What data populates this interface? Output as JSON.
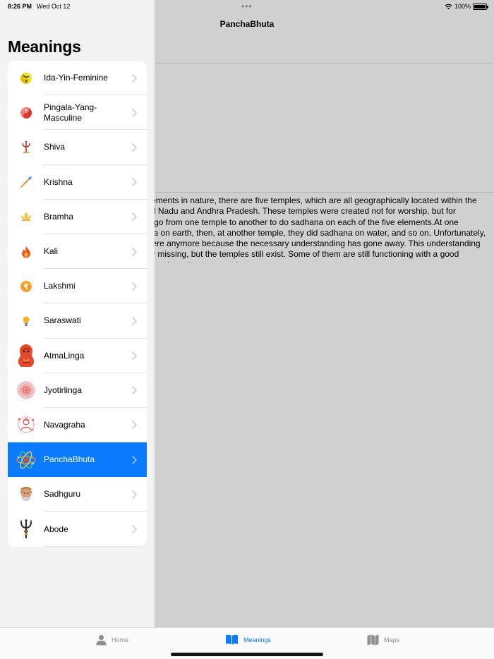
{
  "status_bar": {
    "time": "8:26 PM",
    "date": "Wed Oct 12",
    "dots": "•••",
    "battery": "100%",
    "battery_level": 1.0
  },
  "detail": {
    "title": "PanchaBhuta",
    "body": "Just as there are five elements in nature, there are five temples, which are all geographically located within the Deccan plateau, in Tamil Nadu and Andhra Pradesh. These temples were created not for worship, but for sadhana. People would go from one temple to another to do sadhana on each of the five elements.At one temple, they did sadhana on earth, then, at another temple, they did sadhana on water, and so on. Unfortunately, this connection is not there anymore because the necessary understanding has gone away. This understanding and mastery is generally missing, but the temples still exist. Some of them are still functioning with a good quality, while some of them have become weak."
  },
  "sidebar": {
    "title": "Meanings",
    "items": [
      {
        "label": "Ida-Yin-Feminine",
        "icon": "yin-icon"
      },
      {
        "label": "Pingala-Yang-Masculine",
        "icon": "yang-icon"
      },
      {
        "label": "Shiva",
        "icon": "trident-icon"
      },
      {
        "label": "Krishna",
        "icon": "flute-icon"
      },
      {
        "label": "Bramha",
        "icon": "lotus-icon"
      },
      {
        "label": "Kali",
        "icon": "flame-icon"
      },
      {
        "label": "Lakshmi",
        "icon": "rupee-coin-icon"
      },
      {
        "label": "Saraswati",
        "icon": "lightbulb-icon"
      },
      {
        "label": "AtmaLinga",
        "icon": "meditating-figure-icon"
      },
      {
        "label": "Jyotirlinga",
        "icon": "sunburst-icon"
      },
      {
        "label": "Navagraha",
        "icon": "navagraha-figure-icon"
      },
      {
        "label": "PanchaBhuta",
        "icon": "atom-icon",
        "selected": true
      },
      {
        "label": "Sadhguru",
        "icon": "sadhguru-portrait-icon"
      },
      {
        "label": "Abode",
        "icon": "abode-trident-icon"
      }
    ]
  },
  "tab_bar": {
    "tabs": [
      {
        "label": "Home",
        "icon": "person-icon",
        "active": false
      },
      {
        "label": "Meanings",
        "icon": "book-icon",
        "active": true
      },
      {
        "label": "Maps",
        "icon": "map-icon",
        "active": false
      }
    ]
  },
  "colors": {
    "accent": "#0a7aff",
    "sidebar_bg": "#f3f3f3",
    "detail_bg": "#d0d0d0"
  }
}
